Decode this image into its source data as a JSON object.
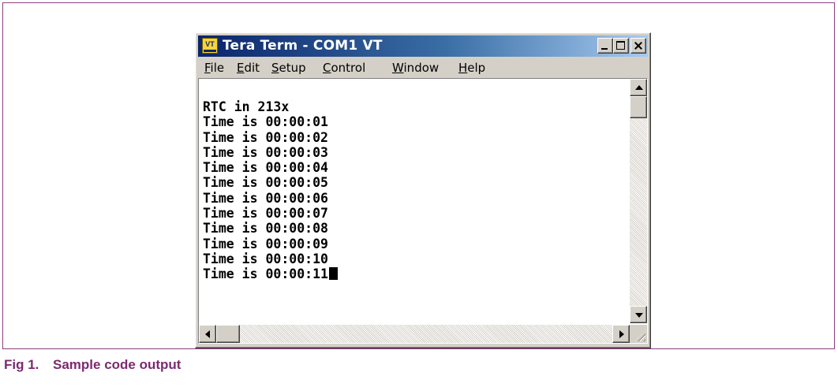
{
  "window": {
    "title": "Tera Term - COM1 VT",
    "icon_text": "VT"
  },
  "menu": [
    {
      "label": "File",
      "accel": "F",
      "rest": "ile"
    },
    {
      "label": "Edit",
      "accel": "E",
      "rest": "dit"
    },
    {
      "label": "Setup",
      "accel": "S",
      "rest": "etup"
    },
    {
      "label": "Control",
      "accel": "C",
      "rest": "ontrol"
    },
    {
      "label": "Window",
      "accel": "W",
      "rest": "indow"
    },
    {
      "label": "Help",
      "accel": "H",
      "rest": "elp"
    }
  ],
  "terminal": {
    "lines": [
      "RTC in 213x",
      "Time is 00:00:01",
      "Time is 00:00:02",
      "Time is 00:00:03",
      "Time is 00:00:04",
      "Time is 00:00:05",
      "Time is 00:00:06",
      "Time is 00:00:07",
      "Time is 00:00:08",
      "Time is 00:00:09",
      "Time is 00:00:10",
      "Time is 00:00:11"
    ]
  },
  "caption": {
    "number": "Fig 1.",
    "text": "Sample code output"
  },
  "colors": {
    "caption": "#7b2a6f",
    "frame": "#8a3f7e",
    "titlebar_start": "#0a246a",
    "titlebar_end": "#a6caf0"
  }
}
